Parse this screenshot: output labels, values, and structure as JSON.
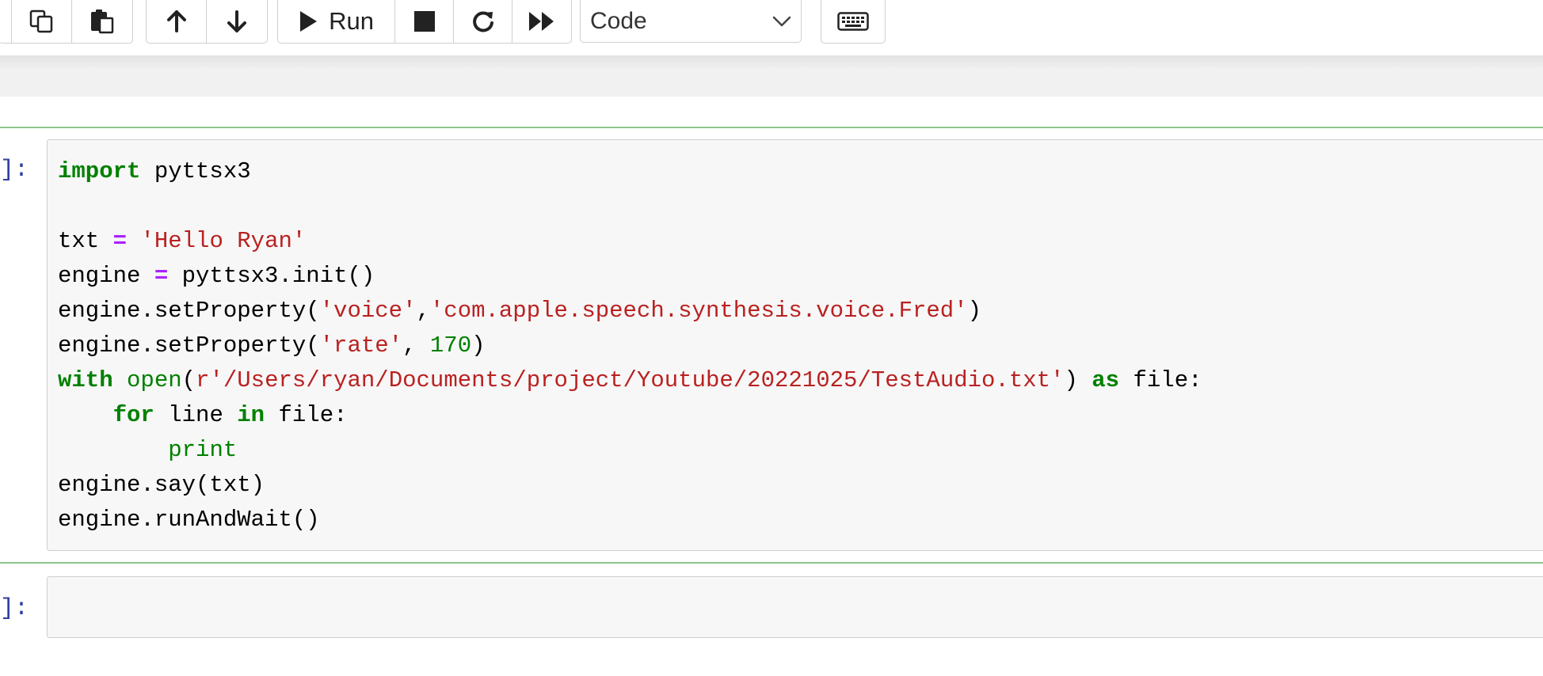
{
  "toolbar": {
    "run_label": "Run",
    "cell_type": "Code",
    "cell_type_options": [
      "Code"
    ]
  },
  "cells": [
    {
      "prompt": "]:",
      "code_lines": [
        [
          {
            "t": "import",
            "c": "kw"
          },
          {
            "t": " pyttsx3"
          }
        ],
        [],
        [
          {
            "t": "txt "
          },
          {
            "t": "=",
            "c": "op"
          },
          {
            "t": " "
          },
          {
            "t": "'Hello Ryan'",
            "c": "str"
          }
        ],
        [
          {
            "t": "engine "
          },
          {
            "t": "=",
            "c": "op"
          },
          {
            "t": " pyttsx3.init()"
          }
        ],
        [
          {
            "t": "engine.setProperty("
          },
          {
            "t": "'voice'",
            "c": "str"
          },
          {
            "t": ","
          },
          {
            "t": "'com.apple.speech.synthesis.voice.Fred'",
            "c": "str"
          },
          {
            "t": ")"
          }
        ],
        [
          {
            "t": "engine.setProperty("
          },
          {
            "t": "'rate'",
            "c": "str"
          },
          {
            "t": ", "
          },
          {
            "t": "170",
            "c": "num"
          },
          {
            "t": ")"
          }
        ],
        [
          {
            "t": "with",
            "c": "kw"
          },
          {
            "t": " "
          },
          {
            "t": "open",
            "c": "bi"
          },
          {
            "t": "("
          },
          {
            "t": "r'/Users/ryan/Documents/project/Youtube/20221025/TestAudio.txt'",
            "c": "str"
          },
          {
            "t": ") "
          },
          {
            "t": "as",
            "c": "kw"
          },
          {
            "t": " file:"
          }
        ],
        [
          {
            "t": "    "
          },
          {
            "t": "for",
            "c": "kw"
          },
          {
            "t": " line "
          },
          {
            "t": "in",
            "c": "kw"
          },
          {
            "t": " file:"
          }
        ],
        [
          {
            "t": "        "
          },
          {
            "t": "print",
            "c": "bi"
          }
        ],
        [
          {
            "t": "engine.say(txt)"
          }
        ],
        [
          {
            "t": "engine.runAndWait()"
          }
        ]
      ]
    },
    {
      "prompt": "]:",
      "code_lines": []
    }
  ]
}
